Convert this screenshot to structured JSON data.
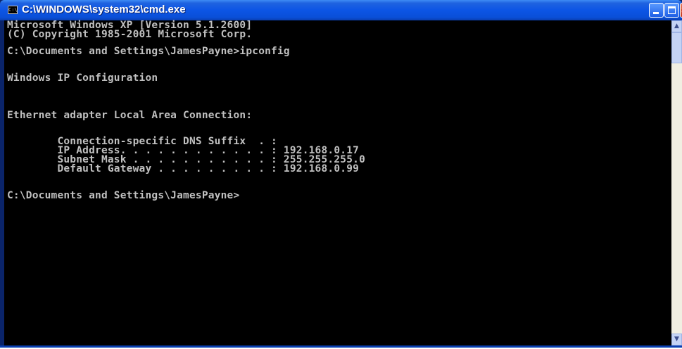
{
  "window": {
    "title": "C:\\WINDOWS\\system32\\cmd.exe",
    "icon": "cmd-icon",
    "icon_glyph": "C:\\",
    "buttons": {
      "minimize_icon": "minimize-icon",
      "maximize_icon": "maximize-icon",
      "close_glyph": "×"
    }
  },
  "console": {
    "lines": [
      "Microsoft Windows XP [Version 5.1.2600]",
      "(C) Copyright 1985-2001 Microsoft Corp.",
      "",
      "C:\\Documents and Settings\\JamesPayne>ipconfig",
      "",
      "Windows IP Configuration",
      "",
      "",
      "Ethernet adapter Local Area Connection:",
      "",
      "        Connection-specific DNS Suffix  . :",
      "        IP Address. . . . . . . . . . . . : 192.168.0.17",
      "        Subnet Mask . . . . . . . . . . . : 255.255.255.0",
      "        Default Gateway . . . . . . . . . : 192.168.0.99",
      "",
      "C:\\Documents and Settings\\JamesPayne>"
    ],
    "text_color": "#c0c0c0",
    "background": "#000000"
  },
  "scrollbar": {
    "up_glyph": "▲",
    "down_glyph": "▼"
  },
  "colors": {
    "titlebar": "#0c55e5",
    "close_button": "#c2351a"
  }
}
